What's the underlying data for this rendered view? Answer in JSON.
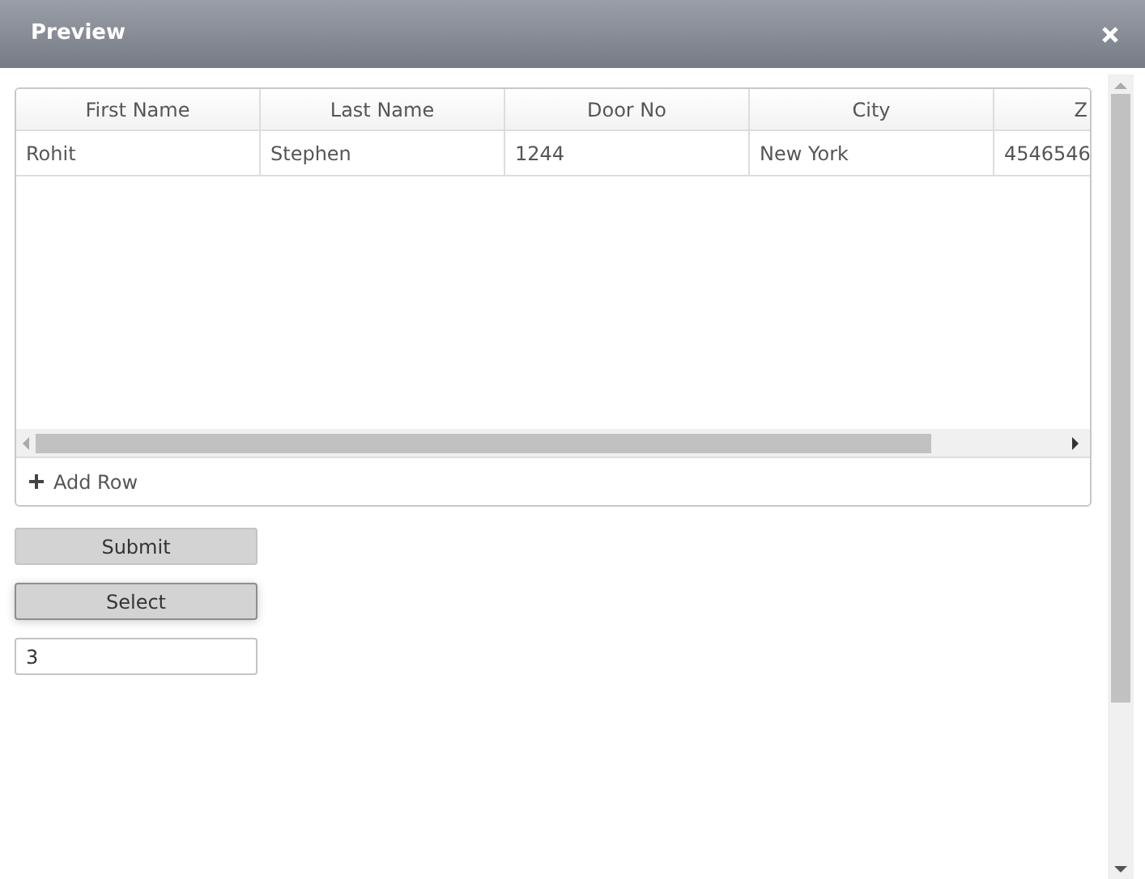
{
  "dialog": {
    "title": "Preview"
  },
  "grid": {
    "columns": [
      "First Name",
      "Last Name",
      "Door No",
      "City",
      "Z"
    ],
    "rows": [
      [
        "Rohit",
        "Stephen",
        "1244",
        "New York",
        "4546546"
      ]
    ],
    "add_row": "Add Row"
  },
  "buttons": [
    {
      "label": "Submit",
      "focused": false
    },
    {
      "label": "Select",
      "focused": true
    }
  ],
  "field": {
    "value": "3"
  }
}
